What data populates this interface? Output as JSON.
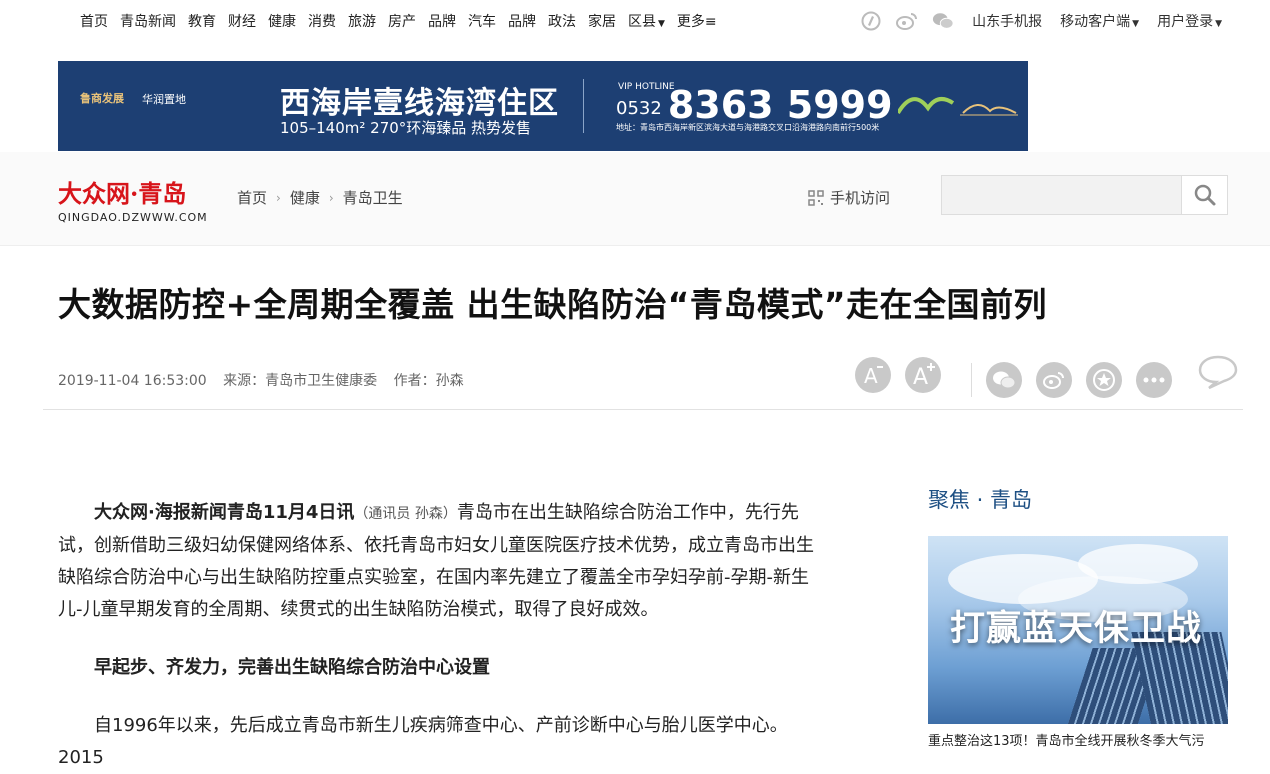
{
  "topnav": {
    "items": [
      "首页",
      "青岛新闻",
      "教育",
      "财经",
      "健康",
      "消费",
      "旅游",
      "房产",
      "品牌",
      "汽车",
      "品牌",
      "政法",
      "家居"
    ],
    "district": "区县",
    "more": "更多≡",
    "right": {
      "mobile_paper": "山东手机报",
      "mobile_client": "移动客户端",
      "login": "用户登录"
    }
  },
  "banner": {
    "logo1": "鲁商发展",
    "logo2": "华润置地",
    "headline": "西海岸壹线海湾住区",
    "sub": "105–140m² 270°环海臻品 热势发售",
    "hotline_label": "VIP HOTLINE",
    "phone_prefix": "0532",
    "phone": "8363 5999",
    "address": "地址：青岛市西海岸新区滨海大道与海港路交叉口沿海港路向南前行500米"
  },
  "header": {
    "brand": "大众网·青岛",
    "domain": "QINGDAO.DZWWW.COM",
    "breadcrumb": [
      "首页",
      "健康",
      "青岛卫生"
    ],
    "mobile_visit": "手机访问",
    "search_placeholder": ""
  },
  "article": {
    "title": "大数据防控+全周期全覆盖 出生缺陷防治“青岛模式”走在全国前列",
    "datetime": "2019-11-04 16:53:00",
    "source": "来源：青岛市卫生健康委",
    "author": "作者：孙森",
    "lead": "大众网·海报新闻青岛11月4日讯",
    "byline": "（通讯员 孙森）",
    "para1": "青岛市在出生缺陷综合防治工作中，先行先试，创新借助三级妇幼保健网络体系、依托青岛市妇女儿童医院医疗技术优势，成立青岛市出生缺陷综合防治中心与出生缺陷防控重点实验室，在国内率先建立了覆盖全市孕妇孕前-孕期-新生儿-儿童早期发育的全周期、续贯式的出生缺陷防治模式，取得了良好成效。",
    "heading1": "早起步、齐发力，完善出生缺陷综合防治中心设置",
    "para2": "自1996年以来，先后成立青岛市新生儿疾病筛查中心、产前诊断中心与胎儿医学中心。2015"
  },
  "sidebar": {
    "title": "聚焦 · 青岛",
    "image_text": "打赢蓝天保卫战",
    "caption": "重点整治这13项！青岛市全线开展秋冬季大气污"
  },
  "colors": {
    "brand_red": "#d7141a",
    "side_title": "#1d4f83",
    "banner_bg": "#1d3f73"
  }
}
